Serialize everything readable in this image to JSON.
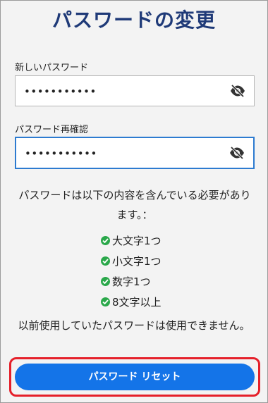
{
  "page": {
    "title": "パスワードの変更"
  },
  "new_password": {
    "label": "新しいパスワード",
    "value": "•••••••••••",
    "toggle_icon": "eye-off-icon"
  },
  "confirm_password": {
    "label": "パスワード再確認",
    "value": "•••••••••••",
    "toggle_icon": "eye-off-icon"
  },
  "requirements": {
    "intro": "パスワードは以下の内容を含んでいる必要があります。：",
    "items": [
      {
        "label": "大文字1つ"
      },
      {
        "label": "小文字1つ"
      },
      {
        "label": "数字1つ"
      },
      {
        "label": "8文字以上"
      }
    ],
    "check_color": "#2aa84a"
  },
  "note": "以前使用していたパスワードは使用できません。",
  "reset_button": {
    "label": "パスワード リセット",
    "color": "#1474e8"
  },
  "highlight_color": "#e5202a",
  "accent": "#1f3a78"
}
